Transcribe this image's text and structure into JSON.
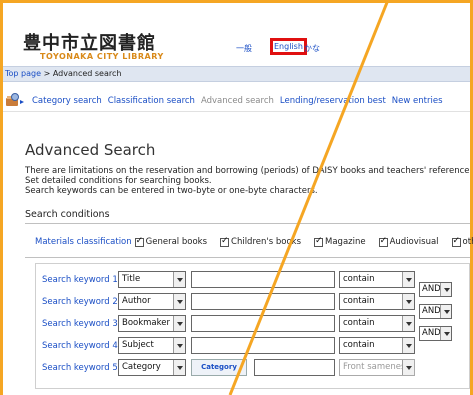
{
  "header": {
    "logo_jp": "豊中市立図書館",
    "logo_en": "TOYONAKA CITY LIBRARY",
    "lang_jp": "一般",
    "lang_en": "English",
    "lang_kana": "かな"
  },
  "breadcrumb": {
    "home": "Top page",
    "separator": " > ",
    "current": "Advanced search"
  },
  "nav": {
    "items": [
      {
        "label": "Category search",
        "active": true
      },
      {
        "label": "Classification search",
        "active": true
      },
      {
        "label": "Advanced search",
        "active": false
      },
      {
        "label": "Lending/reservation best",
        "active": true
      },
      {
        "label": "New entries",
        "active": true
      }
    ]
  },
  "page": {
    "title": "Advanced Search",
    "intro": [
      "There are limitations on the reservation and borrowing (periods) of DAISY books and teachers' reference books",
      "Set detailed conditions for searching books.",
      "Search keywords can be entered in two-byte or one-byte characters."
    ],
    "search_conditions_label": "Search conditions"
  },
  "materials": {
    "label": "Materials classification",
    "options": [
      "General books",
      "Children's books",
      "Magazine",
      "Audiovisual",
      "others"
    ]
  },
  "keywords": [
    {
      "label": "Search keyword 1",
      "field": "Title",
      "condition": "contain",
      "operator": "AND"
    },
    {
      "label": "Search keyword 2",
      "field": "Author",
      "condition": "contain",
      "operator": "AND"
    },
    {
      "label": "Search keyword 3",
      "field": "Bookmaker",
      "condition": "contain",
      "operator": "AND"
    },
    {
      "label": "Search keyword 4",
      "field": "Subject",
      "condition": "contain",
      "operator": ""
    },
    {
      "label": "Search keyword 5",
      "field": "Category",
      "button": "Category",
      "condition": "Front sameness",
      "operator": ""
    }
  ],
  "colors": {
    "link": "#1a4ec5",
    "frame": "#f5a623",
    "highlight": "#e01010",
    "logo_en": "#d98a1a"
  }
}
